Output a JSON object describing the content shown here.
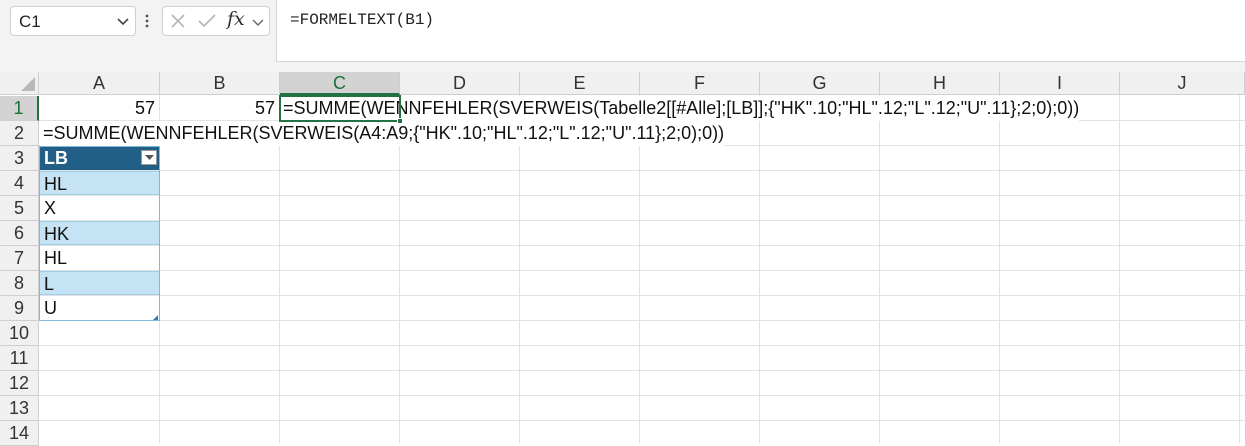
{
  "namebox": {
    "value": "C1"
  },
  "formula_bar": {
    "fx_label": "fx",
    "text": "=FORMELTEXT(B1)"
  },
  "columns": [
    "A",
    "B",
    "C",
    "D",
    "E",
    "F",
    "G",
    "H",
    "I",
    "J"
  ],
  "rows": [
    "1",
    "2",
    "3",
    "4",
    "5",
    "6",
    "7",
    "8",
    "9",
    "10",
    "11",
    "12",
    "13",
    "14"
  ],
  "cells": {
    "A1": "57",
    "B1": "57",
    "C1": "=SUMME(WENNFEHLER(SVERWEIS(Tabelle2[[#Alle];[LB]];{\"HK\".10;\"HL\".12;\"L\".12;\"U\".11};2;0);0))",
    "A2": "=SUMME(WENNFEHLER(SVERWEIS(A4:A9;{\"HK\".10;\"HL\".12;\"L\".12;\"U\".11};2;0);0))"
  },
  "table": {
    "header": "LB",
    "values": [
      "HL",
      "X",
      "HK",
      "HL",
      "L",
      "U"
    ]
  },
  "colors": {
    "accent": "#217346",
    "table_header": "#215f87",
    "table_band": "#c5e3f4"
  }
}
